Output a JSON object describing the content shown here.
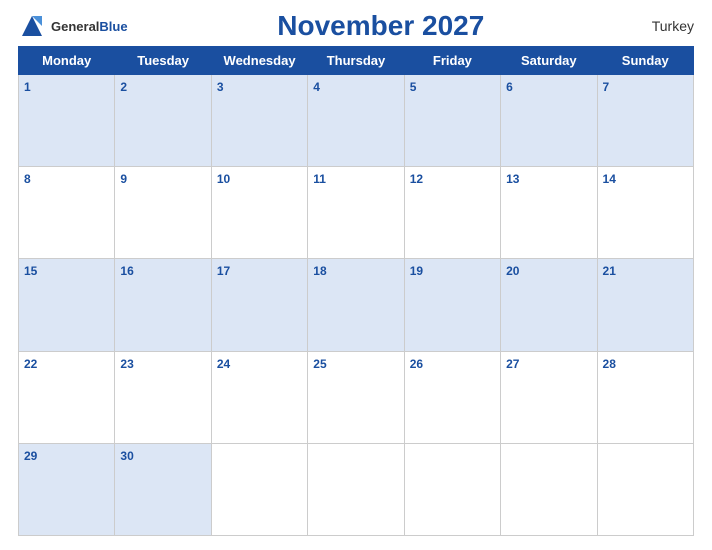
{
  "header": {
    "title": "November 2027",
    "country": "Turkey",
    "logo_general": "General",
    "logo_blue": "Blue"
  },
  "weekdays": [
    "Monday",
    "Tuesday",
    "Wednesday",
    "Thursday",
    "Friday",
    "Saturday",
    "Sunday"
  ],
  "rows": [
    {
      "style": "blue",
      "days": [
        {
          "num": "1",
          "empty": false
        },
        {
          "num": "2",
          "empty": false
        },
        {
          "num": "3",
          "empty": false
        },
        {
          "num": "4",
          "empty": false
        },
        {
          "num": "5",
          "empty": false
        },
        {
          "num": "6",
          "empty": false
        },
        {
          "num": "7",
          "empty": false
        }
      ]
    },
    {
      "style": "white",
      "days": [
        {
          "num": "8",
          "empty": false
        },
        {
          "num": "9",
          "empty": false
        },
        {
          "num": "10",
          "empty": false
        },
        {
          "num": "11",
          "empty": false
        },
        {
          "num": "12",
          "empty": false
        },
        {
          "num": "13",
          "empty": false
        },
        {
          "num": "14",
          "empty": false
        }
      ]
    },
    {
      "style": "blue",
      "days": [
        {
          "num": "15",
          "empty": false
        },
        {
          "num": "16",
          "empty": false
        },
        {
          "num": "17",
          "empty": false
        },
        {
          "num": "18",
          "empty": false
        },
        {
          "num": "19",
          "empty": false
        },
        {
          "num": "20",
          "empty": false
        },
        {
          "num": "21",
          "empty": false
        }
      ]
    },
    {
      "style": "white",
      "days": [
        {
          "num": "22",
          "empty": false
        },
        {
          "num": "23",
          "empty": false
        },
        {
          "num": "24",
          "empty": false
        },
        {
          "num": "25",
          "empty": false
        },
        {
          "num": "26",
          "empty": false
        },
        {
          "num": "27",
          "empty": false
        },
        {
          "num": "28",
          "empty": false
        }
      ]
    },
    {
      "style": "blue",
      "days": [
        {
          "num": "29",
          "empty": false
        },
        {
          "num": "30",
          "empty": false
        },
        {
          "num": "",
          "empty": true
        },
        {
          "num": "",
          "empty": true
        },
        {
          "num": "",
          "empty": true
        },
        {
          "num": "",
          "empty": true
        },
        {
          "num": "",
          "empty": true
        }
      ]
    }
  ],
  "colors": {
    "header_bg": "#1a4fa0",
    "row_blue": "#dce6f5",
    "row_white": "#ffffff",
    "day_number": "#1a4fa0"
  }
}
